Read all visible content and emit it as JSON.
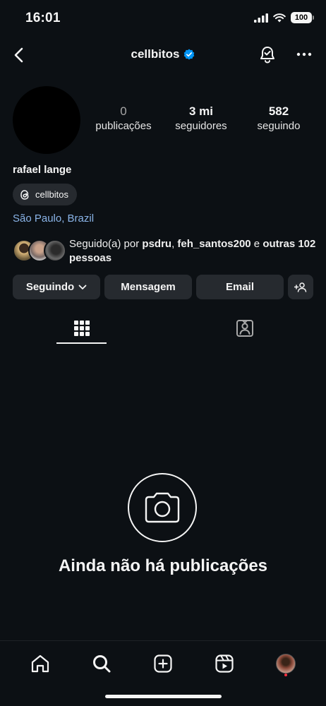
{
  "status_bar": {
    "time": "16:01",
    "battery": "100"
  },
  "header": {
    "username": "cellbitos"
  },
  "profile": {
    "stats": [
      {
        "number": "0",
        "label": "publicações"
      },
      {
        "number": "3 mi",
        "label": "seguidores"
      },
      {
        "number": "582",
        "label": "seguindo"
      }
    ],
    "full_name": "rafael lange",
    "threads_handle": "cellbitos",
    "location": "São Paulo, Brazil",
    "followed_by": {
      "prefix": "Seguido(a) por ",
      "user1": "psdru",
      "separator": ", ",
      "user2": "feh_santos200",
      "conj": " e ",
      "others": "outras 102 pessoas"
    }
  },
  "actions": {
    "following": "Seguindo",
    "message": "Mensagem",
    "email": "Email"
  },
  "empty_state": {
    "title": "Ainda não há publicações"
  },
  "colors": {
    "background": "#0c1014",
    "button": "#262a2f",
    "link": "#8ab4e8",
    "verified": "#0095f6",
    "notification_dot": "#ff3040"
  }
}
